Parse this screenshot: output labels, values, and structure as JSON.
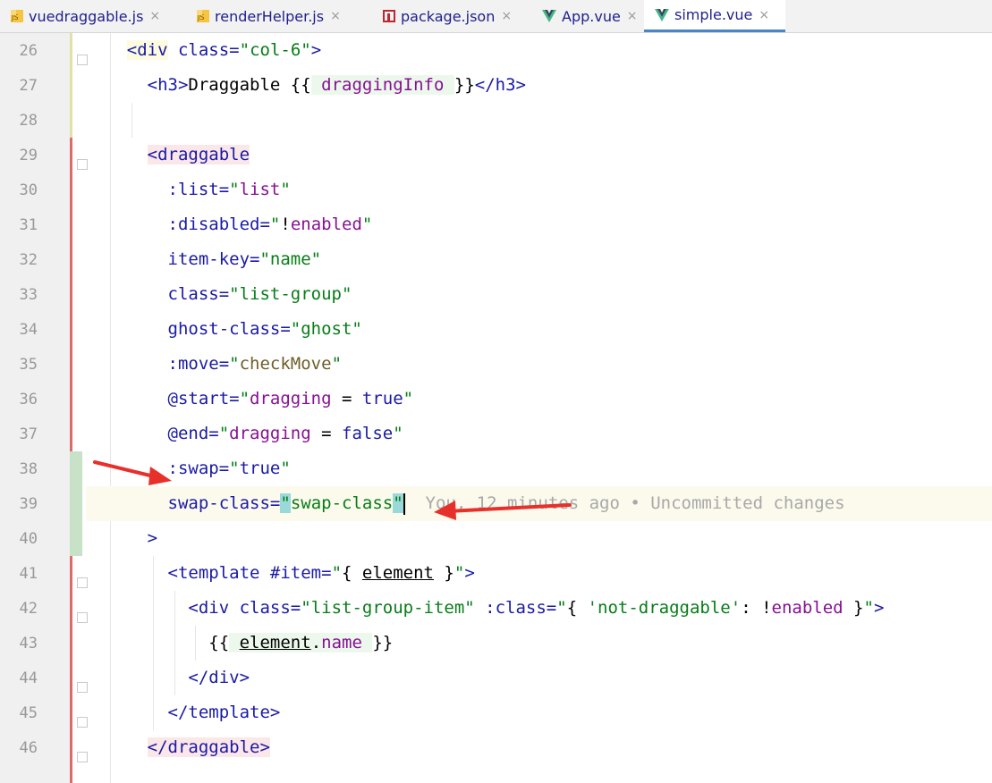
{
  "tabs": [
    {
      "label": "vuedraggable.js",
      "icon": "js-file-icon",
      "active": false
    },
    {
      "label": "renderHelper.js",
      "icon": "js-file-icon",
      "active": false
    },
    {
      "label": "package.json",
      "icon": "json-file-icon",
      "active": false
    },
    {
      "label": "App.vue",
      "icon": "vue-file-icon",
      "active": false
    },
    {
      "label": "simple.vue",
      "icon": "vue-file-icon",
      "active": true
    }
  ],
  "close_glyph": "×",
  "line_numbers": [
    "26",
    "27",
    "28",
    "29",
    "30",
    "31",
    "32",
    "33",
    "34",
    "35",
    "36",
    "37",
    "38",
    "39",
    "40",
    "41",
    "42",
    "43",
    "44",
    "45",
    "46"
  ],
  "blame": "You, 12 minutes ago • Uncommitted changes",
  "annotation_color": "#e8302a"
}
